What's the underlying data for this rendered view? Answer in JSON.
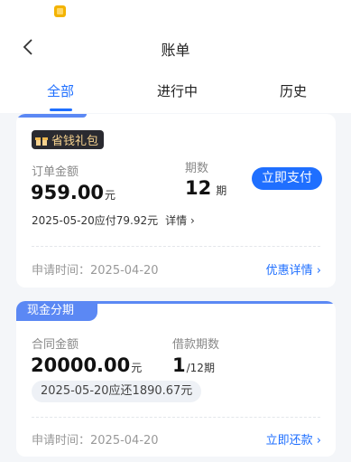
{
  "header": {
    "title": "账单",
    "tabs": [
      "全部",
      "进行中",
      "历史"
    ]
  },
  "card1": {
    "badge": "省钱礼包",
    "order_amount_label": "订单金额",
    "order_amount": "959.00",
    "amount_unit": "元",
    "periods_label": "期数",
    "periods": "12",
    "periods_unit": "期",
    "pay_button": "立即支付",
    "note": "2025-05-20应付79.92元",
    "detail_link": "详情",
    "apply_time": "申请时间：2025-04-20",
    "right_link": "优惠详情"
  },
  "card2": {
    "tag": "现金分期",
    "contract_label": "合同金额",
    "contract_amount": "20000.00",
    "amount_unit": "元",
    "periods_label": "借款期数",
    "current_period": "1",
    "total_period": "/12期",
    "repay_note": "2025-05-20应还1890.67元",
    "apply_time": "申请时间：2025-04-20",
    "right_link": "立即还款"
  },
  "colors": {
    "accent": "#1f6fff",
    "cash_tag": "#5b88f4",
    "badge_bg": "#2a2a30",
    "badge_text": "#f6d28f"
  }
}
